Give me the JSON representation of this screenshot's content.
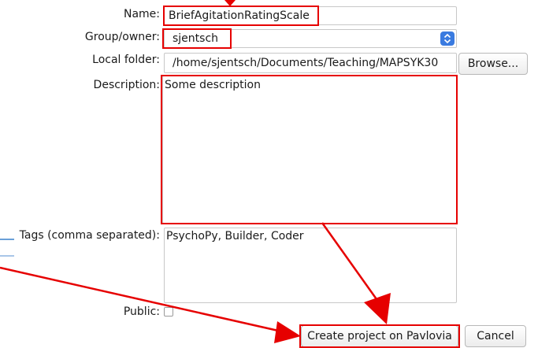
{
  "form": {
    "name_label": "Name:",
    "name_value": "BriefAgitationRatingScale",
    "group_label": "Group/owner:",
    "group_value": "sjentsch",
    "folder_label": "Local folder:",
    "folder_value": "/home/sjentsch/Documents/Teaching/MAPSYK30",
    "browse_label": "Browse...",
    "description_label": "Description:",
    "description_value": "Some description",
    "tags_label": "Tags (comma separated):",
    "tags_value": "PsychoPy, Builder, Coder",
    "public_label": "Public:",
    "public_checked": false
  },
  "buttons": {
    "create_label": "Create project on Pavlovia",
    "cancel_label": "Cancel"
  },
  "annotation": {
    "highlight_color": "#e60000",
    "arrow_color": "#e60000"
  },
  "icons": {
    "select_arrows": "up-down-chevron-icon"
  },
  "colors": {
    "select_button": "#3a7be0"
  }
}
